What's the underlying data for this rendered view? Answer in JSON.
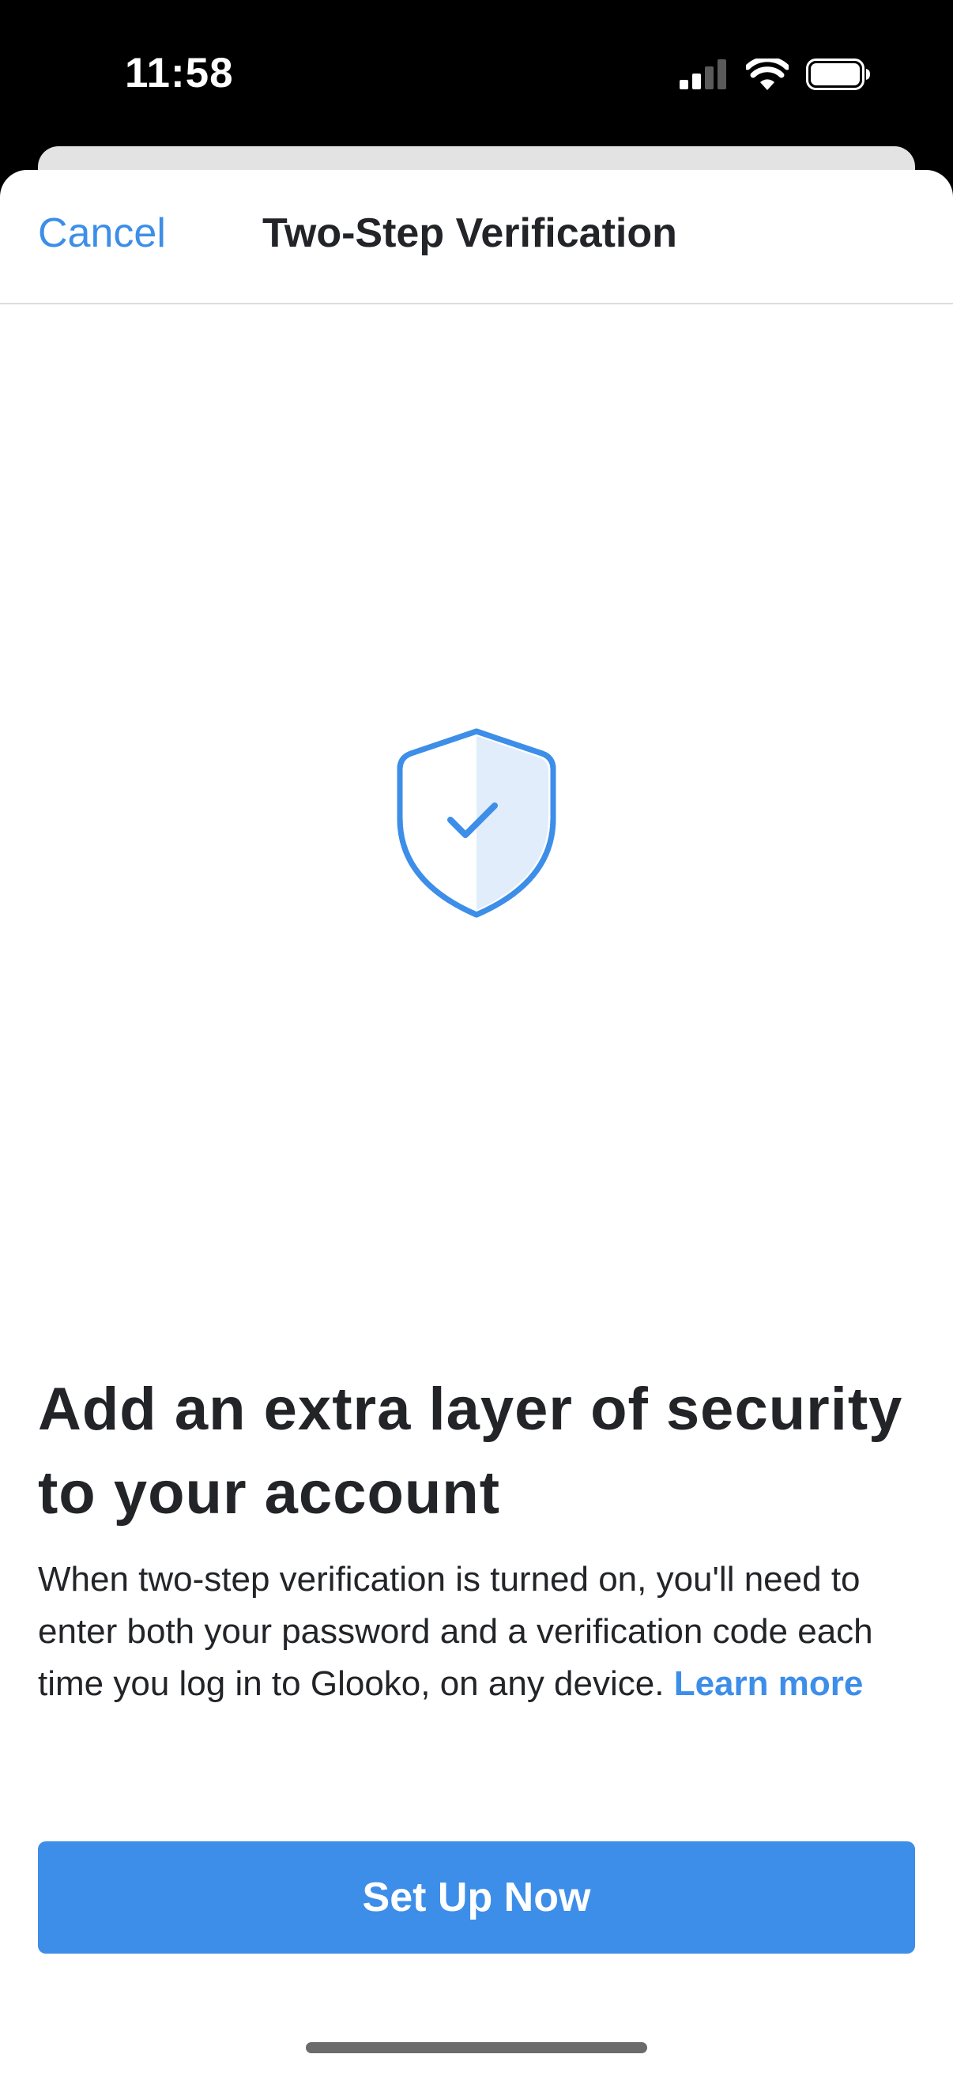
{
  "status_bar": {
    "time": "11:58",
    "icons": [
      "cellular-signal-icon",
      "wifi-icon",
      "battery-icon"
    ]
  },
  "nav": {
    "cancel_label": "Cancel",
    "title": "Two-Step Verification"
  },
  "illustration": {
    "icon": "shield-check-icon"
  },
  "content": {
    "headline": "Add an extra layer of security to your account",
    "body": "When two-step verification is turned on, you'll need to enter both your password and a verification code each time you log in to Glooko, on any device.",
    "learn_more_label": "Learn more"
  },
  "actions": {
    "primary_label": "Set Up Now"
  },
  "colors": {
    "accent": "#3d8ee8",
    "text": "#222428",
    "shield_fill": "#e1edfb",
    "background": "#ffffff"
  }
}
